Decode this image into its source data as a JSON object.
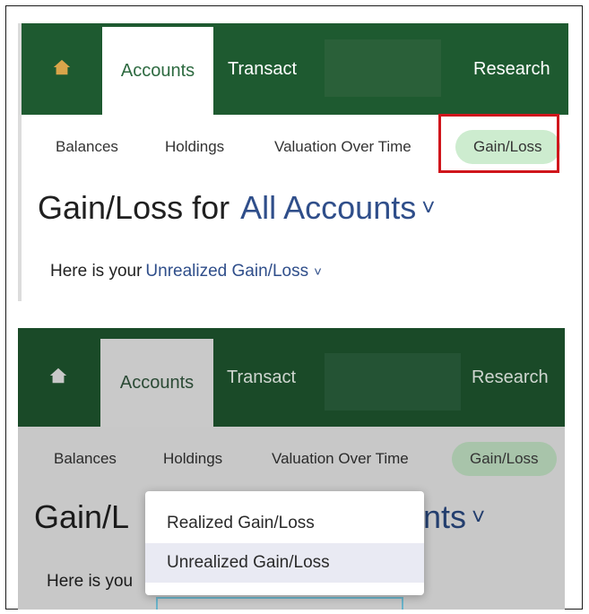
{
  "panel_top": {
    "nav": {
      "home_icon": "home-icon",
      "tabs": [
        {
          "label": "Accounts",
          "active": true
        },
        {
          "label": "Transact",
          "active": false
        },
        {
          "label": "Research",
          "active": false
        }
      ]
    },
    "subnav": {
      "items": [
        {
          "label": "Balances"
        },
        {
          "label": "Holdings"
        },
        {
          "label": "Valuation Over Time"
        },
        {
          "label": "Gain/Loss",
          "selected": true
        }
      ]
    },
    "title": {
      "prefix": "Gain/Loss for",
      "account": "All Accounts",
      "chevron": "˅"
    },
    "here": {
      "prefix": "Here is your",
      "link": "Unrealized Gain/Loss",
      "chevron": "˅"
    }
  },
  "panel_bottom": {
    "nav": {
      "home_icon": "home-icon",
      "tabs": [
        {
          "label": "Accounts",
          "active": true
        },
        {
          "label": "Transact",
          "active": false
        },
        {
          "label": "Research",
          "active": false
        }
      ]
    },
    "subnav": {
      "items": [
        {
          "label": "Balances"
        },
        {
          "label": "Holdings"
        },
        {
          "label": "Valuation Over Time"
        },
        {
          "label": "Gain/Loss",
          "selected": true
        }
      ]
    },
    "title": {
      "prefix": "Gain/L",
      "account": "nts",
      "chevron": "˅"
    },
    "here": {
      "prefix": "Here is you"
    },
    "dropdown": {
      "options": [
        {
          "label": "Realized Gain/Loss",
          "selected": false
        },
        {
          "label": "Unrealized Gain/Loss",
          "selected": true
        }
      ]
    }
  },
  "colors": {
    "nav_green": "#1e5a30",
    "pill_green": "#cdeccf",
    "highlight_red": "#d0161c",
    "link_blue": "#2f4e8a"
  }
}
